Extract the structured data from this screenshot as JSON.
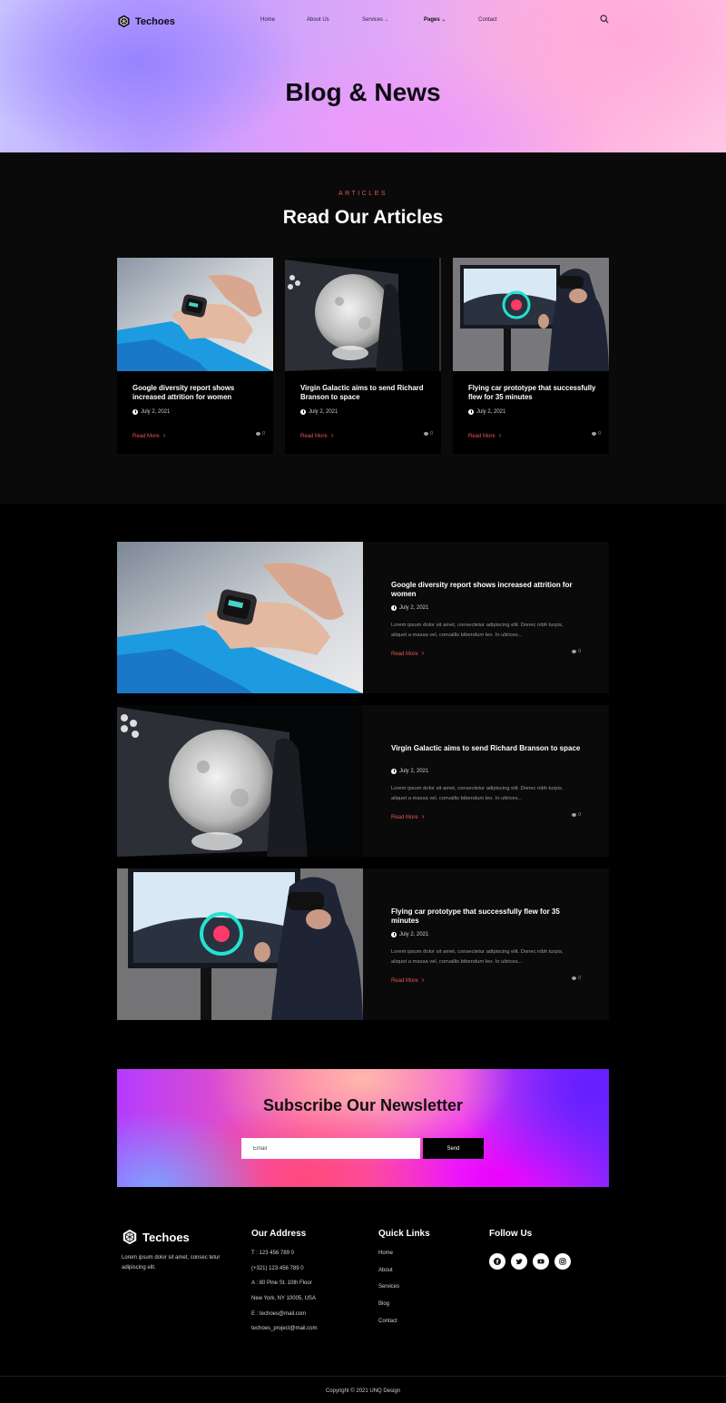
{
  "brand": {
    "name": "Techoes"
  },
  "nav": {
    "items": [
      "Home",
      "About Us",
      "Services",
      "Pages",
      "Contact"
    ],
    "active": "Pages"
  },
  "hero": {
    "title": "Blog & News"
  },
  "articles_section": {
    "eyebrow": "ARTICLES",
    "title": "Read Our Articles"
  },
  "cards": [
    {
      "title": "Google diversity report shows increased attrition for women",
      "date": "July 2, 2021",
      "read_more": "Read More",
      "comments": "0"
    },
    {
      "title": "Virgin Galactic aims to send Richard Branson to space",
      "date": "July 2, 2021",
      "read_more": "Read More",
      "comments": "0"
    },
    {
      "title": "Flying car prototype that successfully flew for 35 minutes",
      "date": "July 2, 2021",
      "read_more": "Read More",
      "comments": "0"
    }
  ],
  "posts": [
    {
      "title": "Google diversity report shows increased attrition for women",
      "date": "July 2, 2021",
      "excerpt": "Lorem ipsum dolor sit amet, consectetur adipiscing elit. Donec nibh turpis, aliquet a massa vel, convallis bibendum leo. In ultrices...",
      "read_more": "Read More",
      "comments": "0"
    },
    {
      "title": "Virgin Galactic aims to send Richard Branson to space",
      "date": "July 2, 2021",
      "excerpt": "Lorem ipsum dolor sit amet, consectetur adipiscing elit. Donec nibh turpis, aliquet a massa vel, convallis bibendum leo. In ultrices...",
      "read_more": "Read More",
      "comments": "0"
    },
    {
      "title": "Flying car prototype that successfully flew for 35 minutes",
      "date": "July 2, 2021",
      "excerpt": "Lorem ipsum dolor sit amet, consectetur adipiscing elit. Donec nibh turpis, aliquet a massa vel, convallis bibendum leo. In ultrices...",
      "read_more": "Read More",
      "comments": "0"
    }
  ],
  "newsletter": {
    "title": "Subscribe Our Newsletter",
    "placeholder": "Email",
    "button": "Send"
  },
  "footer": {
    "about": "Lorem ipsum dolor sit amet, consec tetur adipiscing elit.",
    "address_title": "Our Address",
    "address": [
      "T : 123 456 789 0",
      "(+321) 123 456 789 0",
      "A : 80 Pine St. 10th Floor",
      "New York, NY 10005, USA",
      "E : techoes@mail.com",
      "techoes_project@mail.com"
    ],
    "links_title": "Quick Links",
    "links": [
      "Home",
      "About",
      "Services",
      "Blog",
      "Contact"
    ],
    "follow_title": "Follow Us",
    "socials": [
      "facebook-icon",
      "twitter-icon",
      "youtube-icon",
      "instagram-icon"
    ],
    "copyright": "Copyright © 2021 UNQ Design"
  }
}
